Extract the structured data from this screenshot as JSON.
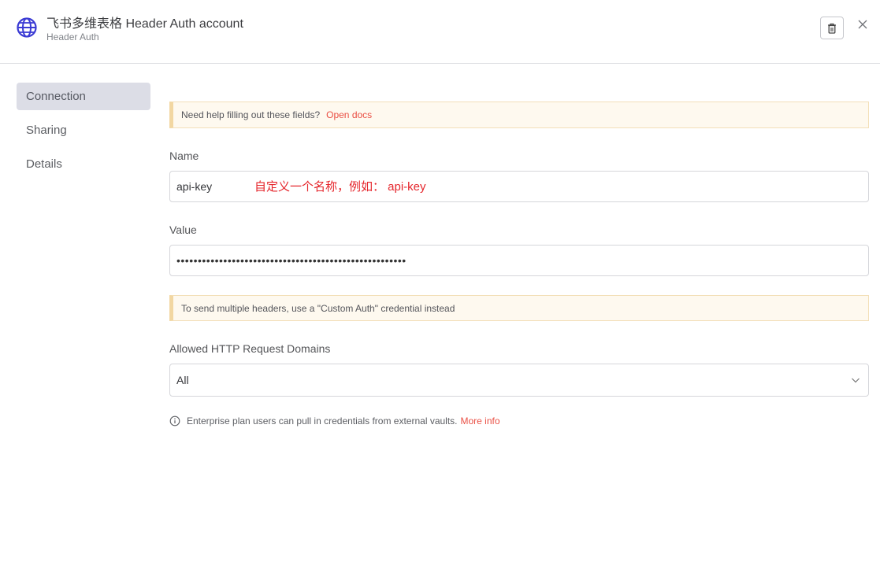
{
  "header": {
    "title": "飞书多维表格 Header Auth account",
    "subtitle": "Header Auth",
    "icon": "globe-icon",
    "accent": "#3b3bd4"
  },
  "sidebar": {
    "items": [
      {
        "label": "Connection",
        "active": true
      },
      {
        "label": "Sharing",
        "active": false
      },
      {
        "label": "Details",
        "active": false
      }
    ]
  },
  "help_notice": {
    "text": "Need help filling out these fields?",
    "link": "Open docs"
  },
  "name_field": {
    "label": "Name",
    "value": "api-key",
    "annotation": "自定义一个名称，例如： api-key"
  },
  "value_field": {
    "label": "Value",
    "masked_value": "••••••••••••••••••••••••••••••••••••••••••••••••••••••"
  },
  "headers_notice": {
    "text": "To send multiple headers, use a \"Custom Auth\" credential instead"
  },
  "domains_field": {
    "label": "Allowed HTTP Request Domains",
    "selected": "All"
  },
  "enterprise_info": {
    "text": "Enterprise plan users can pull in credentials from external vaults.",
    "link": "More info"
  },
  "colors": {
    "link": "#ea4f44",
    "annotation": "#e5252b",
    "notice_bg": "#fef9ef",
    "notice_border": "#f2d7a2"
  }
}
